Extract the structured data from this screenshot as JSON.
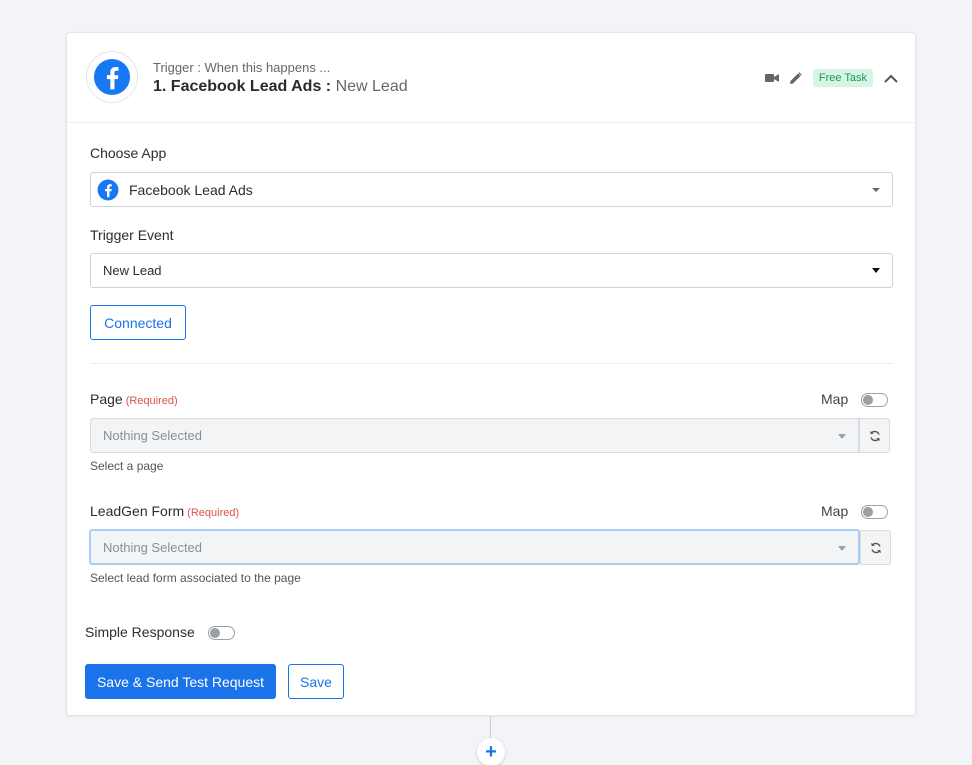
{
  "header": {
    "caption": "Trigger : When this happens ...",
    "title_prefix": "1. Facebook Lead Ads : ",
    "title_event": "New Lead",
    "badge": "Free Task"
  },
  "choose_app": {
    "label": "Choose App",
    "value": "Facebook Lead Ads"
  },
  "trigger_event": {
    "label": "Trigger Event",
    "value": "New Lead"
  },
  "connected_button": "Connected",
  "page_field": {
    "label": "Page",
    "required": "(Required)",
    "map_label": "Map",
    "value": "Nothing Selected",
    "help": "Select a page"
  },
  "leadgen_field": {
    "label": "LeadGen Form",
    "required": "(Required)",
    "map_label": "Map",
    "value": "Nothing Selected",
    "help": "Select lead form associated to the page"
  },
  "simple_response": {
    "label": "Simple Response"
  },
  "actions": {
    "save_test": "Save & Send Test Request",
    "save": "Save"
  },
  "add_step": "+",
  "colors": {
    "accent": "#1a73e8",
    "facebook": "#1877f2",
    "badge_bg": "#d6f5e4",
    "badge_text": "#1a9a57",
    "required": "#d9534f"
  },
  "icons": [
    "facebook-icon",
    "video-camera-icon",
    "pencil-icon",
    "chevron-up-icon",
    "caret-down-icon",
    "refresh-icon",
    "plus-icon"
  ]
}
